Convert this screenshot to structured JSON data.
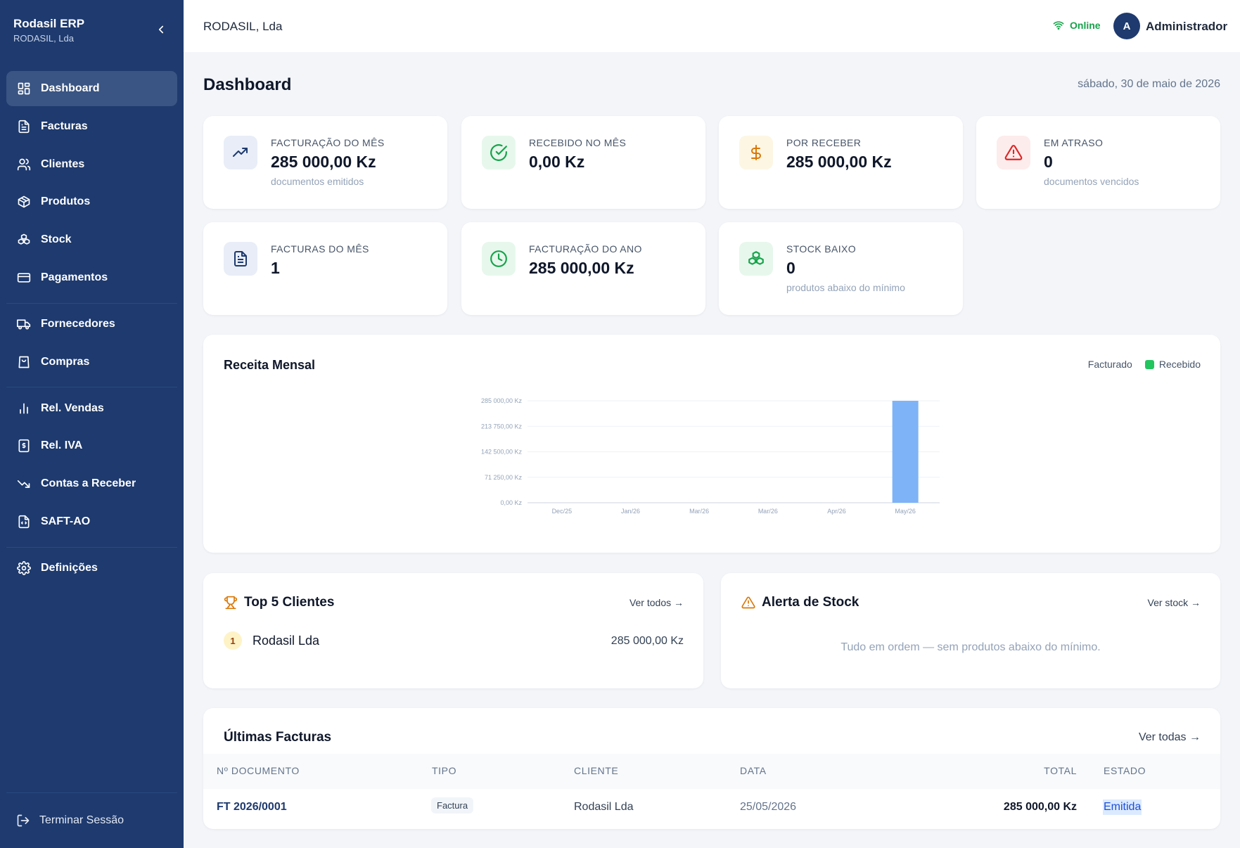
{
  "sidebar": {
    "brand_title": "Rodasil ERP",
    "brand_sub": "RODASIL, Lda",
    "items": [
      {
        "label": "Dashboard",
        "icon": "dashboard-icon"
      },
      {
        "label": "Facturas",
        "icon": "document-icon"
      },
      {
        "label": "Clientes",
        "icon": "users-icon"
      },
      {
        "label": "Produtos",
        "icon": "box-icon"
      },
      {
        "label": "Stock",
        "icon": "boxes-icon"
      },
      {
        "label": "Pagamentos",
        "icon": "credit-card-icon"
      },
      {
        "label": "Fornecedores",
        "icon": "truck-icon"
      },
      {
        "label": "Compras",
        "icon": "shopping-bag-icon"
      },
      {
        "label": "Rel. Vendas",
        "icon": "bar-chart-icon"
      },
      {
        "label": "Rel. IVA",
        "icon": "receipt-icon"
      },
      {
        "label": "Contas a Receber",
        "icon": "trending-down-icon"
      },
      {
        "label": "SAFT-AO",
        "icon": "file-code-icon"
      },
      {
        "label": "Definições",
        "icon": "settings-icon"
      }
    ],
    "logout_label": "Terminar Sessão"
  },
  "header": {
    "company": "RODASIL, Lda",
    "status": "Online",
    "avatar_initial": "A",
    "user": "Administrador"
  },
  "page": {
    "title": "Dashboard",
    "date": "sábado, 30 de maio de 2026"
  },
  "stats": [
    {
      "label": "FACTURAÇÃO DO MÊS",
      "value": "285 000,00 Kz",
      "sub": "documentos emitidos",
      "icon": "trending-up-icon"
    },
    {
      "label": "RECEBIDO NO MÊS",
      "value": "0,00 Kz",
      "sub": "",
      "icon": "check-circle-icon"
    },
    {
      "label": "POR RECEBER",
      "value": "285 000,00 Kz",
      "sub": "",
      "icon": "dollar-icon"
    },
    {
      "label": "EM ATRASO",
      "value": "0",
      "sub": "documentos vencidos",
      "icon": "alert-triangle-icon"
    },
    {
      "label": "FACTURAS DO MÊS",
      "value": "1",
      "sub": "",
      "icon": "file-text-icon"
    },
    {
      "label": "FACTURAÇÃO DO ANO",
      "value": "285 000,00 Kz",
      "sub": "",
      "icon": "clock-icon"
    },
    {
      "label": "STOCK BAIXO",
      "value": "0",
      "sub": "produtos abaixo do mínimo",
      "icon": "boxes-icon"
    }
  ],
  "colors": {
    "sidebar": "#1e3a6e",
    "bar": "#7eb3f7",
    "online": "#16a34a",
    "recebido": "#22c55e",
    "warning": "#d97706",
    "danger": "#dc2626"
  },
  "chart": {
    "title": "Receita Mensal",
    "legend_facturado": "Facturado",
    "legend_recebido": "Recebido"
  },
  "chart_data": {
    "type": "bar",
    "title": "Receita Mensal",
    "categories": [
      "Dec/25",
      "Jan/26",
      "Mar/26",
      "Mar/26",
      "Apr/26",
      "May/26"
    ],
    "series": [
      {
        "name": "Facturado",
        "values": [
          0,
          0,
          0,
          0,
          0,
          285000
        ]
      },
      {
        "name": "Recebido",
        "values": [
          0,
          0,
          0,
          0,
          0,
          0
        ]
      }
    ],
    "y_ticks": [
      "0,00 Kz",
      "71 250,00 Kz",
      "142 500,00 Kz",
      "213 750,00 Kz",
      "285 000,00 Kz"
    ],
    "y_tick_values": [
      0,
      71250,
      142500,
      213750,
      285000
    ],
    "ylim": [
      0,
      285000
    ],
    "grid": true,
    "legend": "top-right"
  },
  "top_clients": {
    "title": "Top 5 Clientes",
    "link": "Ver todos →",
    "items": [
      {
        "rank": "1",
        "name": "Rodasil Lda",
        "value": "285 000,00 Kz"
      }
    ]
  },
  "stock_alert": {
    "title": "Alerta de Stock",
    "link": "Ver stock →",
    "message": "Tudo em ordem — sem produtos abaixo do mínimo."
  },
  "invoices": {
    "title": "Últimas Facturas",
    "link": "Ver todas →",
    "columns": [
      "Nº DOCUMENTO",
      "TIPO",
      "CLIENTE",
      "DATA",
      "TOTAL",
      "ESTADO"
    ],
    "rows": [
      {
        "doc": "FT 2026/0001",
        "tipo": "Factura",
        "cliente": "Rodasil Lda",
        "data": "25/05/2026",
        "total": "285 000,00 Kz",
        "estado": "Emitida"
      }
    ]
  }
}
